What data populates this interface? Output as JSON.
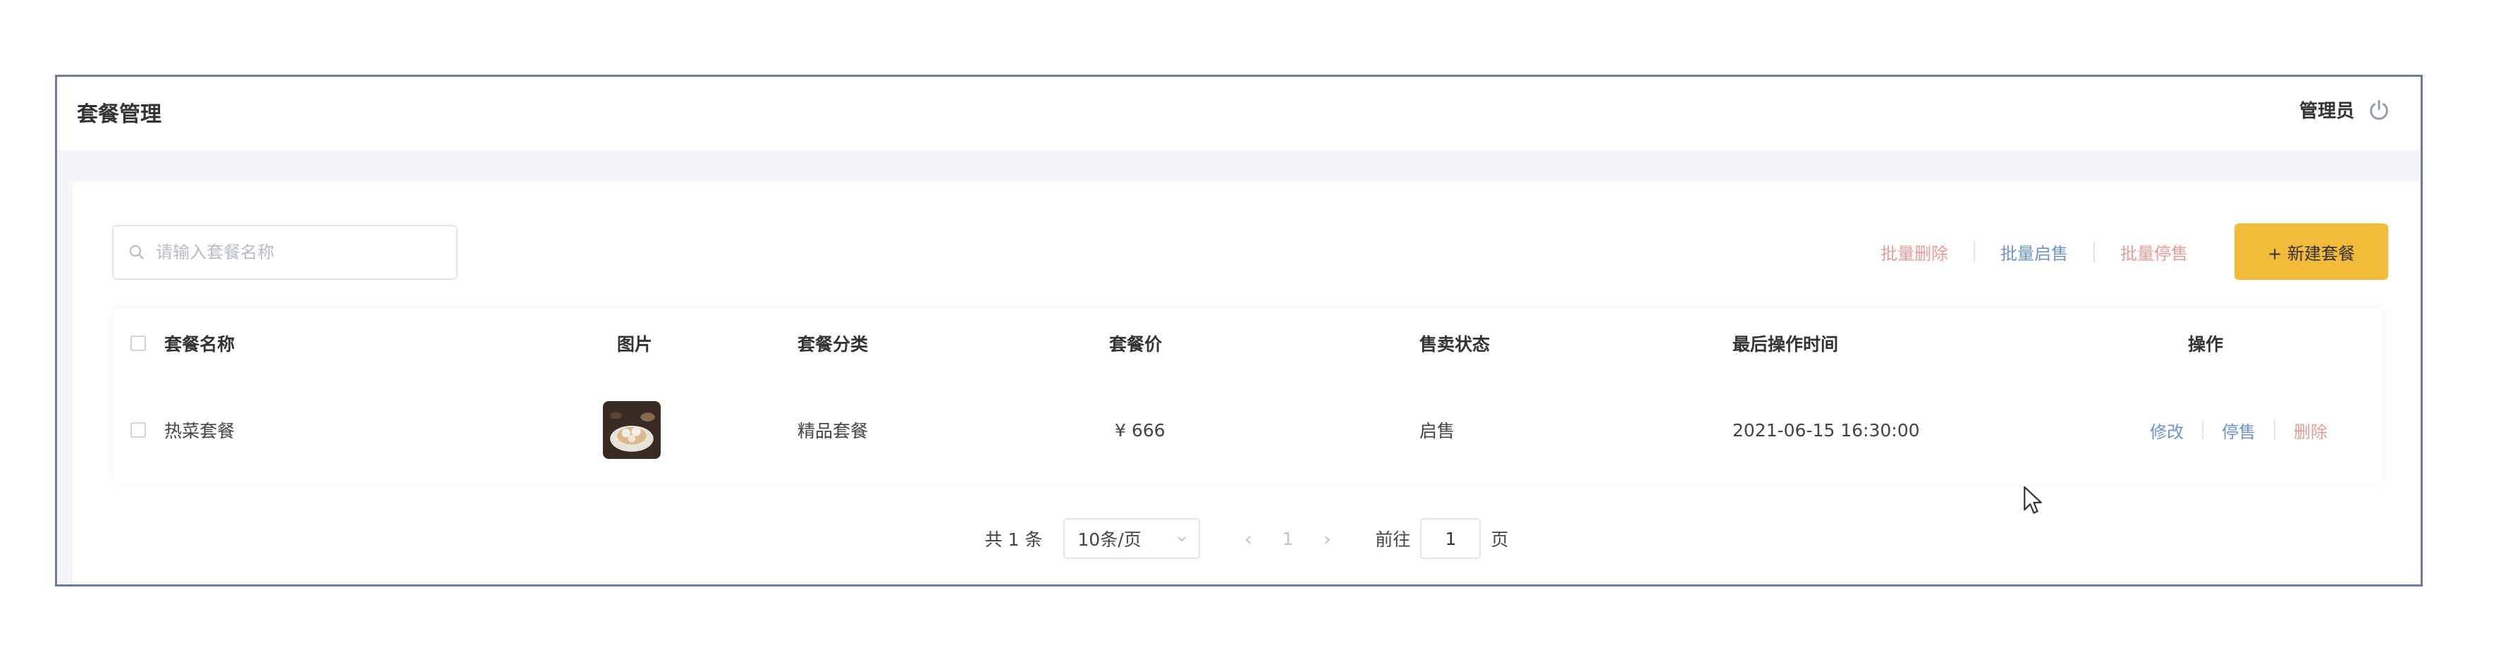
{
  "header": {
    "title": "套餐管理",
    "admin_name": "管理员",
    "power_icon": "power-icon"
  },
  "toolbar": {
    "search_placeholder": "请输入套餐名称",
    "search_value": "",
    "batch_delete_label": "批量删除",
    "batch_enable_label": "批量启售",
    "batch_disable_label": "批量停售",
    "new_label": "+ 新建套餐",
    "colors": {
      "batch_delete": "#e79b94",
      "batch_enable": "#6c93c9",
      "batch_disable": "#e79b94",
      "primary_button": "#f3bb3a"
    }
  },
  "table": {
    "columns": [
      "套餐名称",
      "图片",
      "套餐分类",
      "套餐价",
      "售卖状态",
      "最后操作时间",
      "操作"
    ],
    "rows": [
      {
        "name": "热菜套餐",
        "image_icon": "dish-thumbnail",
        "category": "精品套餐",
        "price": "¥ 666",
        "status": "启售",
        "updated_at": "2021-06-15 16:30:00",
        "actions": {
          "edit": "修改",
          "toggle": "停售",
          "delete": "删除"
        }
      }
    ],
    "action_colors": {
      "edit": "#6c93c9",
      "toggle": "#6c93c9",
      "delete": "#e79b94"
    }
  },
  "pagination": {
    "total": "共 1 条",
    "page_size": "10条/页",
    "current_page": "1",
    "goto_label": "前往",
    "goto_value": "1",
    "page_suffix": "页"
  }
}
